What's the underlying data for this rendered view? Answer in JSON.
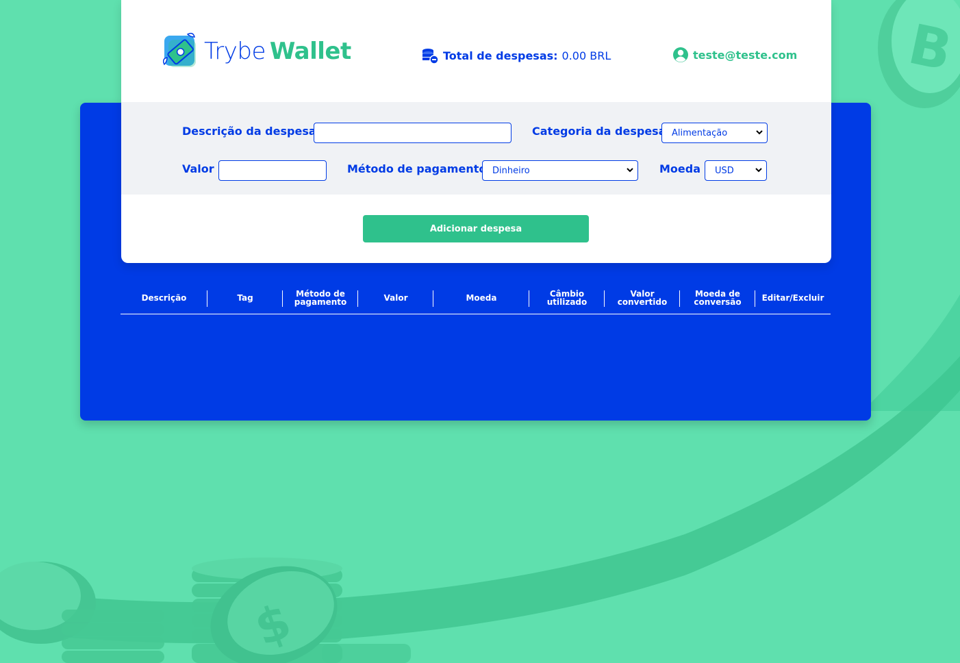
{
  "brand": {
    "name_part1": "Trybe",
    "name_part2": "Wallet"
  },
  "header": {
    "total_label": "Total de despesas:",
    "total_value": "0.00",
    "currency": "BRL",
    "user_email": "teste@teste.com"
  },
  "form": {
    "description_label": "Descrição da despesa",
    "description_value": "",
    "category_label": "Categoria da despesa",
    "category_selected": "Alimentação",
    "value_label": "Valor",
    "value_value": "",
    "method_label": "Método de pagamento",
    "method_selected": "Dinheiro",
    "currency_label": "Moeda",
    "currency_selected": "USD",
    "submit_label": "Adicionar despesa"
  },
  "table": {
    "headers": [
      "Descrição",
      "Tag",
      "Método de pagamento",
      "Valor",
      "Moeda",
      "Câmbio utilizado",
      "Valor convertido",
      "Moeda de conversão",
      "Editar/Excluir"
    ],
    "rows": []
  },
  "colors": {
    "primary_blue": "#003be5",
    "accent_green": "#2fc18c",
    "background_green": "#5fe0ae"
  }
}
